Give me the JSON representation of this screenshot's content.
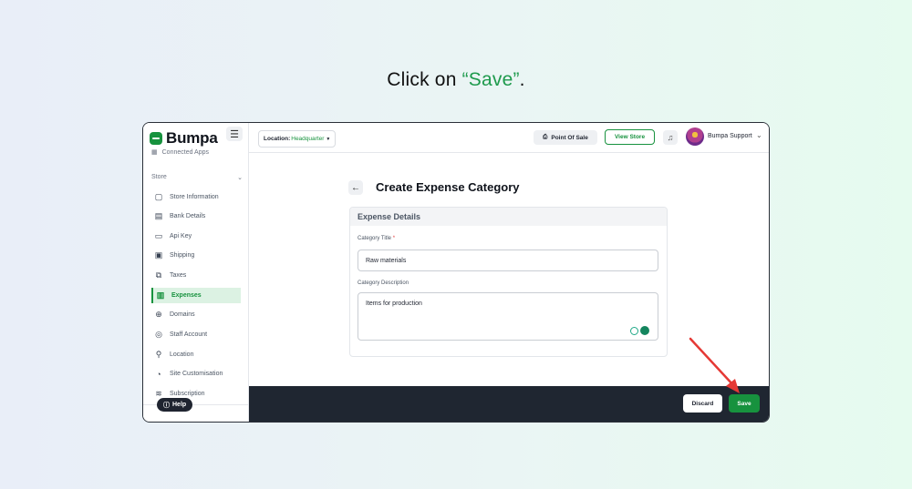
{
  "instruction": {
    "prefix": "Click on ",
    "highlight": "“Save”",
    "suffix": "."
  },
  "sidebar": {
    "logo": "Bumpa",
    "cut_item": "Connected Apps",
    "section": "Store",
    "items": [
      {
        "label": "Store Information",
        "icon": "store-icon"
      },
      {
        "label": "Bank Details",
        "icon": "bank-icon"
      },
      {
        "label": "Api Key",
        "icon": "api-key-icon"
      },
      {
        "label": "Shipping",
        "icon": "shipping-icon"
      },
      {
        "label": "Taxes",
        "icon": "taxes-icon"
      },
      {
        "label": "Expenses",
        "icon": "expenses-icon",
        "active": true
      },
      {
        "label": "Domains",
        "icon": "globe-icon"
      },
      {
        "label": "Staff Account",
        "icon": "staff-icon"
      },
      {
        "label": "Location",
        "icon": "location-icon"
      },
      {
        "label": "Site Customisation",
        "icon": "palette-icon"
      },
      {
        "label": "Subscription",
        "icon": "layers-icon"
      }
    ],
    "help": "Help"
  },
  "topbar": {
    "location_label": "Location:",
    "location_value": "Headquarter",
    "pos": "Point Of Sale",
    "view_store": "View Store",
    "user": "Bumpa Support"
  },
  "page": {
    "title": "Create Expense Category",
    "card_title": "Expense Details",
    "category_title_label": "Category Title",
    "required_mark": "*",
    "category_title_value": "Raw materials",
    "category_desc_label": "Category Description",
    "category_desc_value": "Items for production"
  },
  "footer": {
    "discard": "Discard",
    "save": "Save"
  },
  "colors": {
    "brand_green": "#17923e",
    "footer_dark": "#1f2631",
    "arrow_red": "#e53935"
  }
}
